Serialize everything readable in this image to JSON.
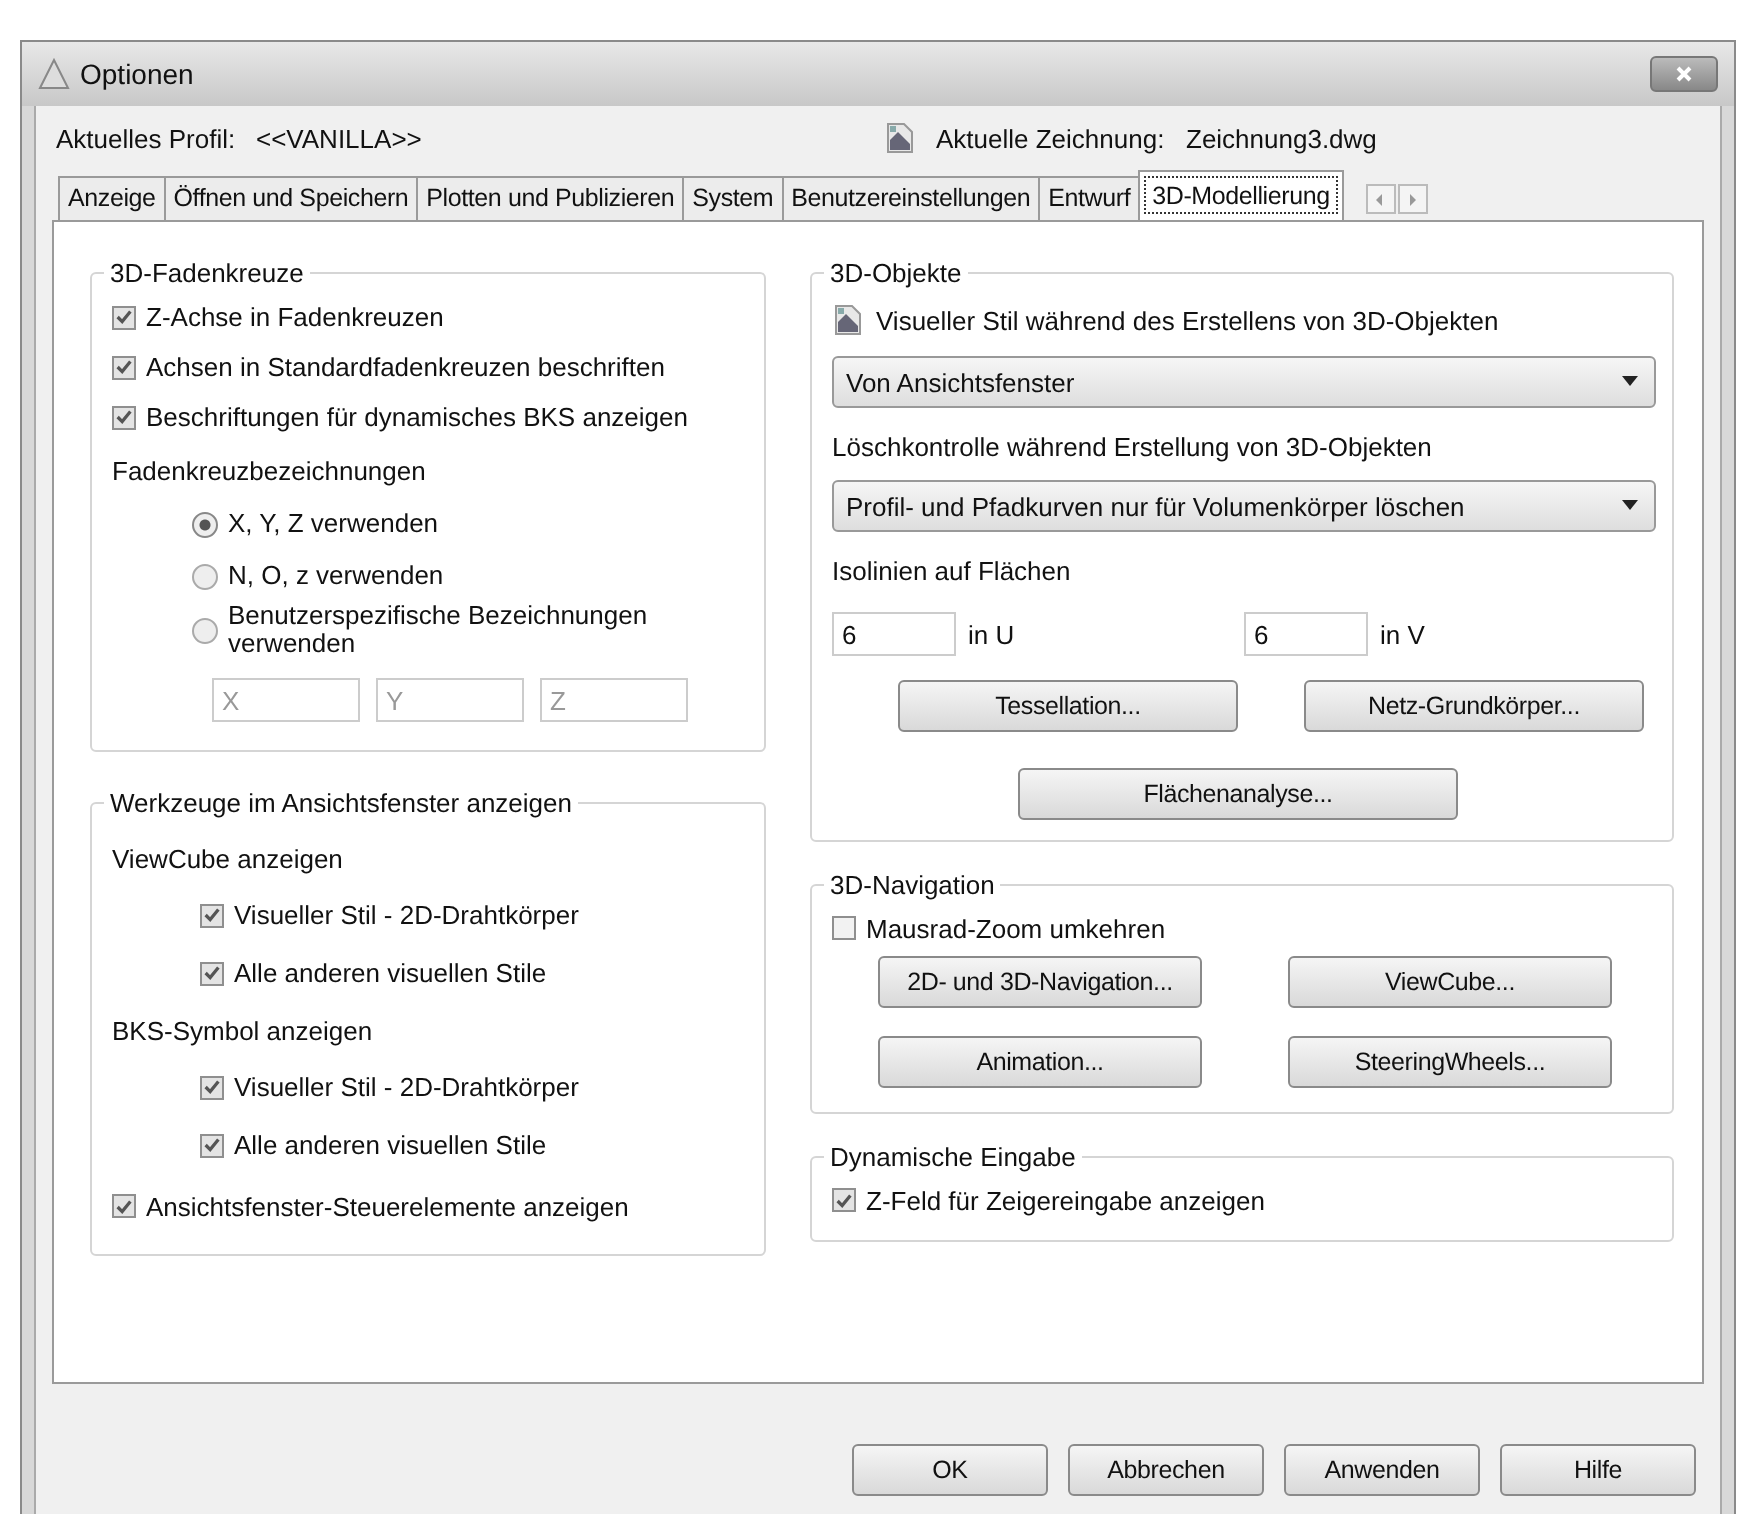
{
  "window": {
    "title": "Optionen"
  },
  "profile": {
    "label": "Aktuelles Profil:",
    "value": "<<VANILLA>>"
  },
  "drawing": {
    "label": "Aktuelle Zeichnung:",
    "value": "Zeichnung3.dwg"
  },
  "tabs": [
    {
      "label": "Anzeige",
      "selected": false
    },
    {
      "label": "Öffnen und Speichern",
      "selected": false
    },
    {
      "label": "Plotten und Publizieren",
      "selected": false
    },
    {
      "label": "System",
      "selected": false
    },
    {
      "label": "Benutzereinstellungen",
      "selected": false
    },
    {
      "label": "Entwurf",
      "selected": false
    },
    {
      "label": "3D-Modellierung",
      "selected": true
    }
  ],
  "crosshairs": {
    "title": "3D-Fadenkreuze",
    "checkboxes": [
      {
        "label": "Z-Achse in Fadenkreuzen",
        "checked": true
      },
      {
        "label": "Achsen in Standardfadenkreuzen beschriften",
        "checked": true
      },
      {
        "label": "Beschriftungen für dynamisches BKS anzeigen",
        "checked": true
      }
    ],
    "labels_heading": "Fadenkreuzbezeichnungen",
    "radios": [
      {
        "label": "X, Y, Z verwenden",
        "selected": true
      },
      {
        "label": "N, O, z verwenden",
        "selected": false
      },
      {
        "label": "Benutzerspezifische Bezeichnungen verwenden",
        "selected": false
      }
    ],
    "fields": [
      {
        "value": "X",
        "disabled": true
      },
      {
        "value": "Y",
        "disabled": true
      },
      {
        "value": "Z",
        "disabled": true
      }
    ]
  },
  "viewport_tools": {
    "title": "Werkzeuge im Ansichtsfenster anzeigen",
    "sections": [
      {
        "heading": "ViewCube anzeigen",
        "checkboxes": [
          {
            "label": "Visueller Stil - 2D-Drahtkörper",
            "checked": true
          },
          {
            "label": "Alle anderen visuellen Stile",
            "checked": true
          }
        ]
      },
      {
        "heading": "BKS-Symbol anzeigen",
        "checkboxes": [
          {
            "label": "Visueller Stil - 2D-Drahtkörper",
            "checked": true
          },
          {
            "label": "Alle anderen visuellen Stile",
            "checked": true
          }
        ]
      }
    ],
    "checkbox": {
      "label": "Ansichtsfenster-Steuerelemente anzeigen",
      "checked": true
    }
  },
  "objects": {
    "title": "3D-Objekte",
    "style_label": "Visueller Stil während des Erstellens von 3D-Objekten",
    "style_select": "Von Ansichtsfenster",
    "delete_label": "Löschkontrolle während Erstellung von 3D-Objekten",
    "delete_select": "Profil- und Pfadkurven nur für Volumenkörper löschen",
    "isolines_label": "Isolinien auf Flächen",
    "isolines": [
      {
        "value": "6",
        "unit": "in U"
      },
      {
        "value": "6",
        "unit": "in V"
      }
    ],
    "buttons": [
      "Tessellation...",
      "Netz-Grundkörper...",
      "Flächenanalyse..."
    ]
  },
  "navigation": {
    "title": "3D-Navigation",
    "checkbox": {
      "label": "Mausrad-Zoom umkehren",
      "checked": false
    },
    "buttons": [
      "2D- und 3D-Navigation...",
      "ViewCube...",
      "Animation...",
      "SteeringWheels..."
    ]
  },
  "dynamic_input": {
    "title": "Dynamische Eingabe",
    "checkbox": {
      "label": "Z-Feld für Zeigereingabe anzeigen",
      "checked": true
    }
  },
  "footer_buttons": [
    "OK",
    "Abbrechen",
    "Anwenden",
    "Hilfe"
  ]
}
